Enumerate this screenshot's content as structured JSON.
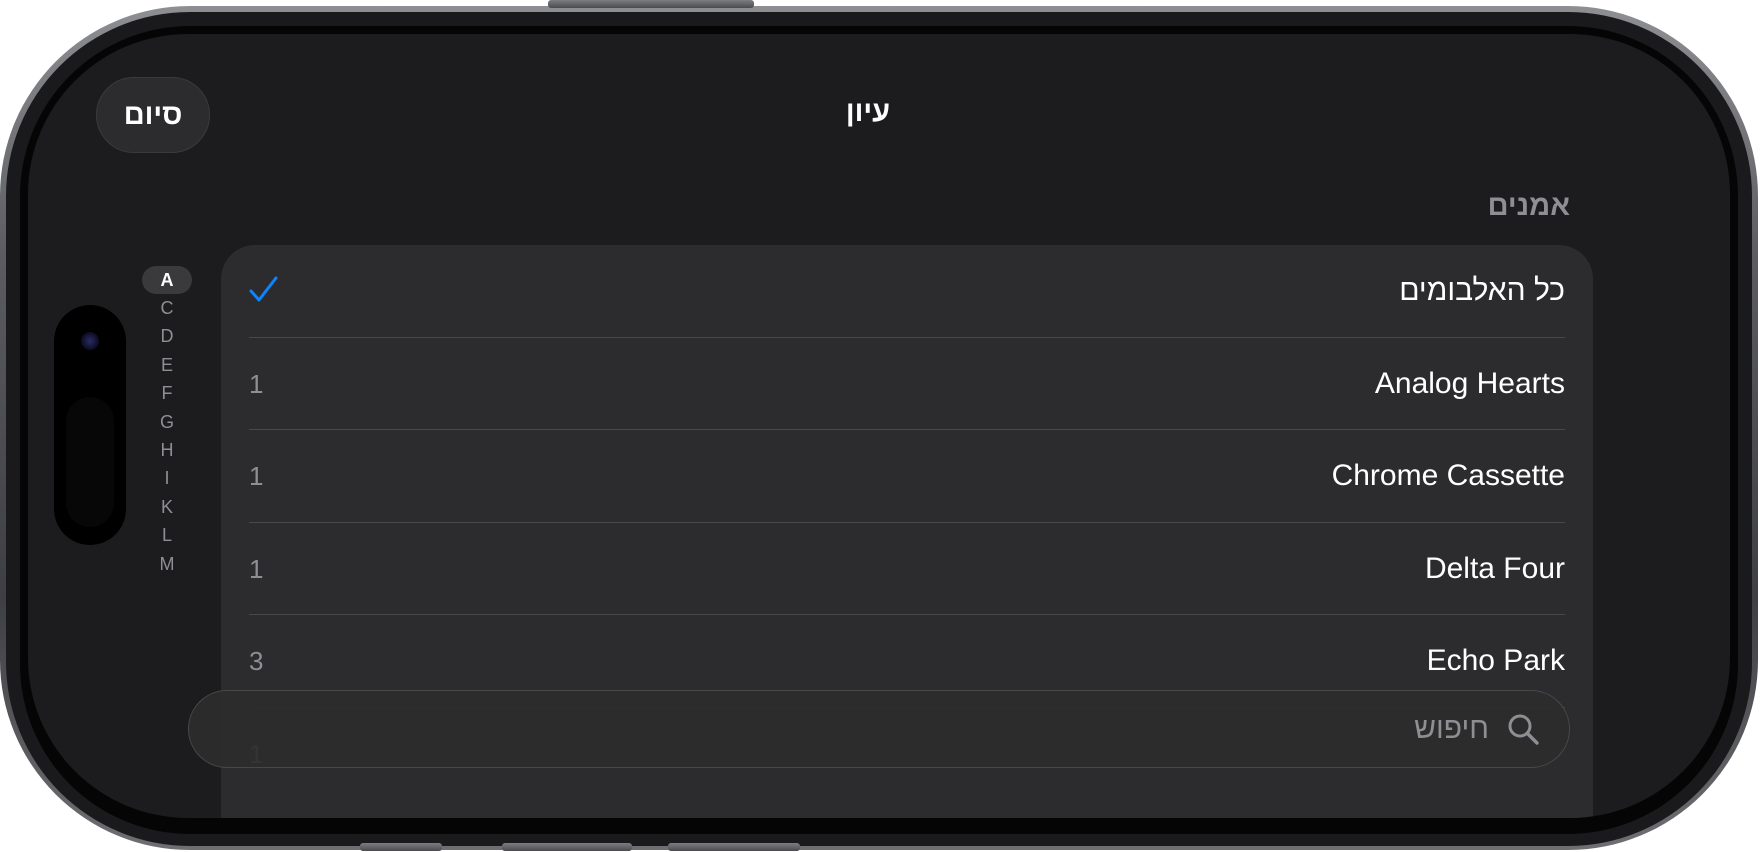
{
  "nav": {
    "done_label": "סיום",
    "title": "עיון"
  },
  "section": {
    "header": "אמנים"
  },
  "index_bar": {
    "letters": [
      "A",
      "C",
      "D",
      "E",
      "F",
      "G",
      "H",
      "I",
      "K",
      "L",
      "M"
    ],
    "active": "A"
  },
  "list": {
    "rows": [
      {
        "label": "כל האלבומים",
        "count": "",
        "selected": true
      },
      {
        "label": "Analog Hearts",
        "count": "1",
        "selected": false
      },
      {
        "label": "Chrome Cassette",
        "count": "1",
        "selected": false
      },
      {
        "label": "Delta Four",
        "count": "1",
        "selected": false
      },
      {
        "label": "Echo Park",
        "count": "3",
        "selected": false
      },
      {
        "label": "",
        "count": "1",
        "selected": false
      }
    ]
  },
  "search": {
    "placeholder": "חיפוש"
  },
  "colors": {
    "background": "#1c1c1e",
    "card": "#2c2c2e",
    "accent": "#0a84ff",
    "secondary_text": "#8e8e93"
  },
  "icons": {
    "check": "checkmark-icon",
    "search": "magnifying-glass-icon"
  }
}
